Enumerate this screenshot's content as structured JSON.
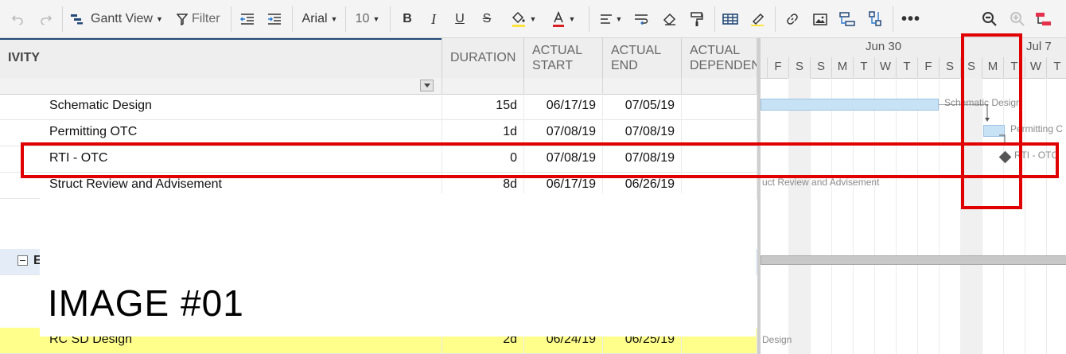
{
  "toolbar": {
    "view_label": "Gantt View",
    "filter_label": "Filter",
    "font_name": "Arial",
    "font_size": "10",
    "colors": {
      "accent": "#254a78",
      "highlight_fill": "#ffe23a",
      "text_color": "#d92020",
      "remove_formatting": "#e5314b"
    }
  },
  "grid": {
    "columns": [
      "IVITY",
      "DURATION",
      "ACTUAL START",
      "ACTUAL END",
      "ACTUAL DEPENDENC"
    ],
    "col_lines": {
      "activity": [
        "IVITY"
      ],
      "duration": [
        "DURATION"
      ],
      "start": [
        "ACTUAL",
        "START"
      ],
      "end": [
        "ACTUAL",
        "END"
      ],
      "dependency": [
        "ACTUAL",
        "DEPENDENC"
      ]
    },
    "rows": [
      {
        "name": "Schematic Design",
        "duration": "15d",
        "start": "06/17/19",
        "end": "07/05/19",
        "dependency": ""
      },
      {
        "name": "Permitting OTC",
        "duration": "1d",
        "start": "07/08/19",
        "end": "07/08/19",
        "dependency": ""
      },
      {
        "name": "RTI - OTC",
        "duration": "0",
        "start": "07/08/19",
        "end": "07/08/19",
        "dependency": ""
      },
      {
        "name": "Struct Review and Advisement",
        "duration": "8d",
        "start": "06/17/19",
        "end": "06/26/19",
        "dependency": ""
      },
      {
        "name": "RC SD Design",
        "duration": "2d",
        "start": "06/24/19",
        "end": "06/25/19",
        "dependency": ""
      }
    ],
    "group_row_label": "E",
    "overlay_label": "IMAGE #01"
  },
  "gantt": {
    "weeks": [
      "Jun 30",
      "Jul 7"
    ],
    "days": [
      "F",
      "S",
      "S",
      "M",
      "T",
      "W",
      "T",
      "F",
      "S",
      "S",
      "M",
      "T",
      "W",
      "T"
    ],
    "labels": {
      "schematic": "Schematic Design",
      "permitting": "Permitting C",
      "rti": "RTI - OTC",
      "struct": "uct Review and Advisement",
      "rcsd": "Design"
    }
  }
}
